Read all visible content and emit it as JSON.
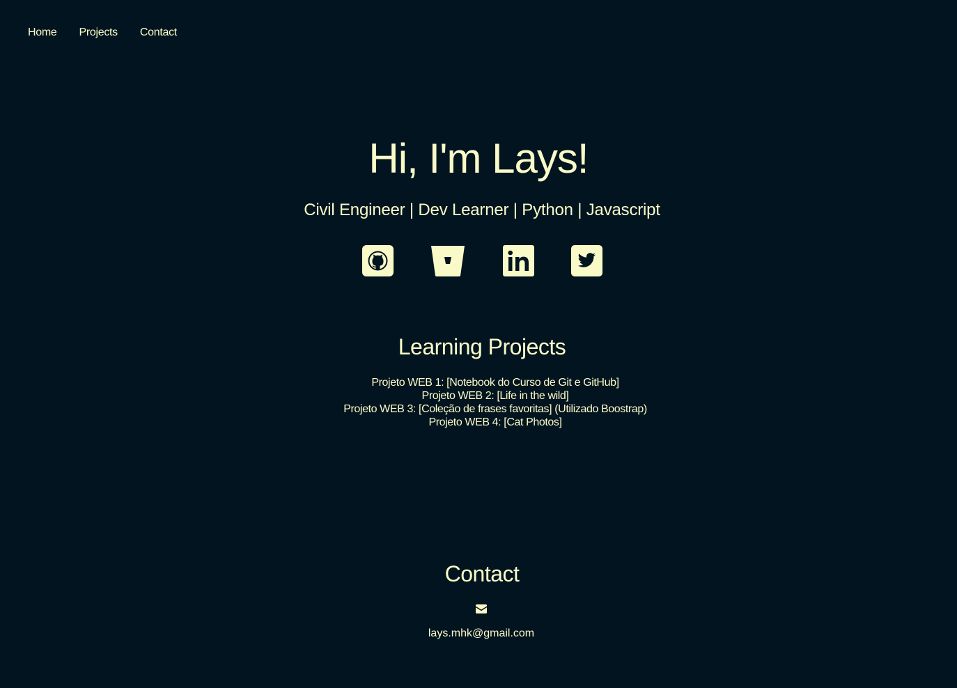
{
  "nav": {
    "items": [
      {
        "label": "Home"
      },
      {
        "label": "Projects"
      },
      {
        "label": "Contact"
      }
    ]
  },
  "hero": {
    "title": "Hi, I'm Lays!",
    "subtitle": "Civil Engineer | Dev Learner | Python | Javascript"
  },
  "socials": [
    {
      "icon": "github-icon"
    },
    {
      "icon": "bitbucket-icon"
    },
    {
      "icon": "linkedin-icon"
    },
    {
      "icon": "twitter-icon"
    }
  ],
  "projects": {
    "title": "Learning Projects",
    "items": [
      {
        "label": "Projeto WEB 1: [Notebook do Curso de Git e GitHub]"
      },
      {
        "label": "Projeto WEB 2: [Life in the wild]"
      },
      {
        "label": "Projeto WEB 3: [Coleção de frases favoritas] (Utilizado Boostrap)"
      },
      {
        "label": "Projeto WEB 4: [Cat Photos]"
      }
    ]
  },
  "contact": {
    "title": "Contact",
    "icon": "envelope-icon",
    "email": "lays.mhk@gmail.com"
  },
  "colors": {
    "background": "#021420",
    "accent": "#fafac8"
  }
}
